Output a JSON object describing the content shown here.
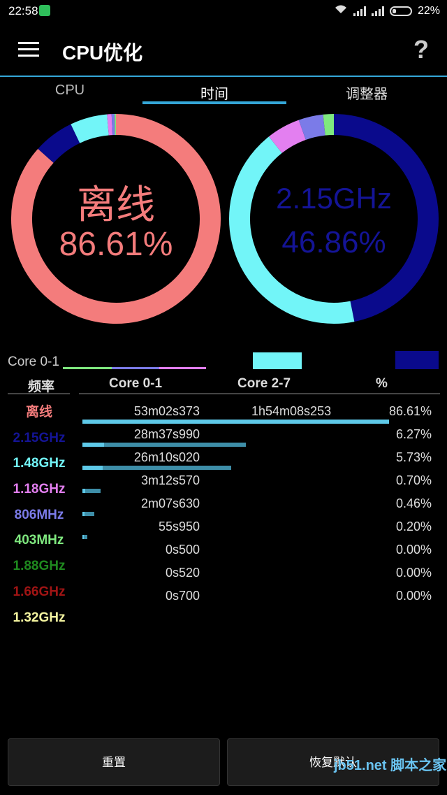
{
  "status": {
    "time": "22:58",
    "battery": "22%"
  },
  "appbar": {
    "title": "CPU优化",
    "help": "?"
  },
  "tabs": [
    "CPU",
    "时间",
    "调整器"
  ],
  "donut_left": {
    "line1": "离线",
    "line2": "86.61%",
    "segments": [
      {
        "color": "#f47c7c",
        "value": 86.61
      },
      {
        "color": "#0a0a8c",
        "value": 6.27
      },
      {
        "color": "#72f5f8",
        "value": 5.73
      },
      {
        "color": "#e37ff0",
        "value": 0.7
      },
      {
        "color": "#7b7be8",
        "value": 0.46
      },
      {
        "color": "#7fe87f",
        "value": 0.2
      }
    ]
  },
  "donut_right": {
    "line1": "2.15GHz",
    "line2": "46.86%",
    "segments": [
      {
        "color": "#0a0a8c",
        "value": 46.86
      },
      {
        "color": "#72f5f8",
        "value": 42.5
      },
      {
        "color": "#e37ff0",
        "value": 5.2
      },
      {
        "color": "#7b7be8",
        "value": 3.8
      },
      {
        "color": "#7fe87f",
        "value": 1.64
      }
    ]
  },
  "legend": {
    "label": "Core 0-1",
    "swatch1": "#72f5f8",
    "swatch2": "#0a0a8c"
  },
  "table": {
    "headers": {
      "freq": "频率",
      "core01": "Core 0-1",
      "core27": "Core 2-7",
      "pct": "%"
    },
    "frequencies": [
      {
        "label": "离线",
        "color": "#f47c7c"
      },
      {
        "label": "2.15GHz",
        "color": "#141496"
      },
      {
        "label": "1.48GHz",
        "color": "#72f5f8"
      },
      {
        "label": "1.18GHz",
        "color": "#e37ff0"
      },
      {
        "label": "806MHz",
        "color": "#7b7be8"
      },
      {
        "label": "403MHz",
        "color": "#7fe87f"
      },
      {
        "label": "1.88GHz",
        "color": "#1f8a1f"
      },
      {
        "label": "1.66GHz",
        "color": "#a01414"
      },
      {
        "label": "1.32GHz",
        "color": "#f5f5a0"
      }
    ],
    "rows": [
      {
        "core01": "53m02s373",
        "core27": "1h54m08s253",
        "pct": "86.61%",
        "bar": 0.845,
        "inner": 0.845
      },
      {
        "core01": "28m37s990",
        "core27": "",
        "pct": "6.27%",
        "bar": 0.45,
        "inner": 0.06
      },
      {
        "core01": "26m10s020",
        "core27": "",
        "pct": "5.73%",
        "bar": 0.41,
        "inner": 0.055
      },
      {
        "core01": "3m12s570",
        "core27": "",
        "pct": "0.70%",
        "bar": 0.05,
        "inner": 0.008
      },
      {
        "core01": "2m07s630",
        "core27": "",
        "pct": "0.46%",
        "bar": 0.033,
        "inner": 0.005
      },
      {
        "core01": "55s950",
        "core27": "",
        "pct": "0.20%",
        "bar": 0.014,
        "inner": 0.003
      },
      {
        "core01": "0s500",
        "core27": "",
        "pct": "0.00%",
        "bar": 0,
        "inner": 0
      },
      {
        "core01": "0s520",
        "core27": "",
        "pct": "0.00%",
        "bar": 0,
        "inner": 0
      },
      {
        "core01": "0s700",
        "core27": "",
        "pct": "0.00%",
        "bar": 0,
        "inner": 0
      }
    ]
  },
  "buttons": {
    "reset": "重置",
    "restore": "恢复默认"
  },
  "watermark": "jb51.net 脚本之家"
}
